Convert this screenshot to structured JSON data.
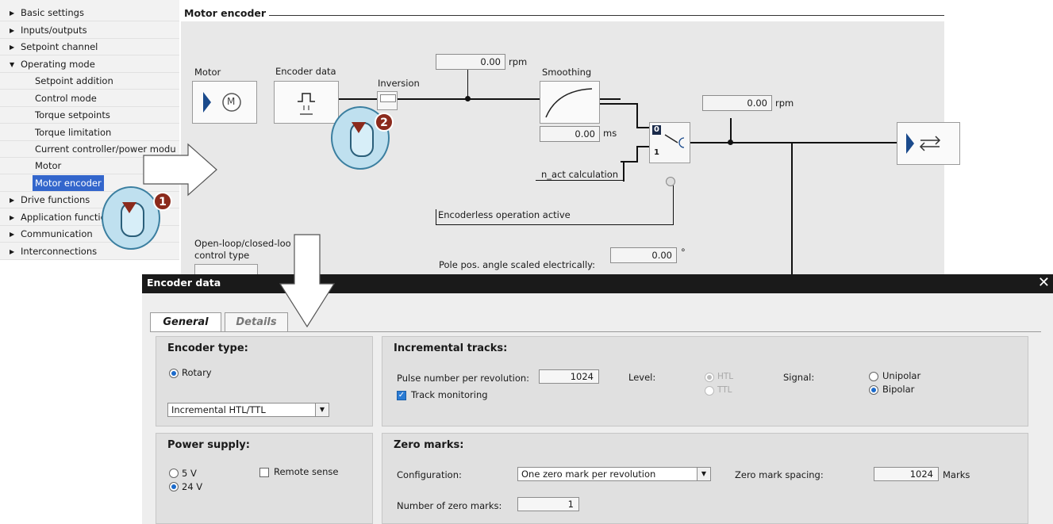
{
  "tree": {
    "items": [
      {
        "label": "Basic settings",
        "arrow": "▶"
      },
      {
        "label": "Inputs/outputs",
        "arrow": "▶"
      },
      {
        "label": "Setpoint channel",
        "arrow": "▶"
      },
      {
        "label": "Operating mode",
        "arrow": "▼"
      },
      {
        "label": "Setpoint addition"
      },
      {
        "label": "Control mode"
      },
      {
        "label": "Torque setpoints"
      },
      {
        "label": "Torque limitation"
      },
      {
        "label": "Current controller/power modu"
      },
      {
        "label": "Motor"
      },
      {
        "label": "Motor encoder"
      },
      {
        "label": "Drive functions",
        "arrow": "▶"
      },
      {
        "label": "Application functic",
        "arrow": "▶"
      },
      {
        "label": "Communication",
        "arrow": "▶"
      },
      {
        "label": "Interconnections",
        "arrow": "▶"
      }
    ]
  },
  "schematic": {
    "title": "Motor encoder",
    "motor_label": "Motor",
    "encoder_data_label": "Encoder data",
    "inversion_label": "Inversion",
    "speed_value_1": "0.00",
    "speed_unit_1": "rpm",
    "smoothing_label": "Smoothing",
    "smoothing_value": "0.00",
    "smoothing_unit": "ms",
    "speed_value_2": "0.00",
    "speed_unit_2": "rpm",
    "nact_label": "n_act calculation",
    "encoderless_label": "Encoderless operation active",
    "switch_0": "0",
    "switch_1": "1",
    "control_type_label_1": "Open-loop/closed-loo",
    "control_type_label_2": "control type",
    "pole_label": "Pole pos. angle scaled electrically:",
    "pole_value": "0.00",
    "pole_unit": "°",
    "motor_symbol": "M"
  },
  "dialog": {
    "title": "Encoder data",
    "close_glyph": "✕",
    "tabs": [
      {
        "label": "General",
        "active": true
      },
      {
        "label": "Details",
        "active": false
      }
    ],
    "encoder_type": {
      "title": "Encoder type:",
      "rotary_label": "Rotary",
      "type_value": "Incremental HTL/TTL"
    },
    "incremental_tracks": {
      "title": "Incremental tracks:",
      "pulse_label": "Pulse number per revolution:",
      "pulse_value": "1024",
      "track_monitoring_label": "Track monitoring",
      "level_label": "Level:",
      "level_options": [
        "HTL",
        "TTL"
      ],
      "signal_label": "Signal:",
      "signal_options": [
        "Unipolar",
        "Bipolar"
      ]
    },
    "power_supply": {
      "title": "Power supply:",
      "options": [
        "5 V",
        "24 V"
      ],
      "remote_sense_label": "Remote sense"
    },
    "zero_marks": {
      "title": "Zero marks:",
      "config_label": "Configuration:",
      "config_value": "One zero mark per revolution",
      "spacing_label": "Zero mark spacing:",
      "spacing_value": "1024",
      "spacing_unit": "Marks",
      "number_label": "Number of zero marks:",
      "number_value": "1"
    }
  },
  "overlay": {
    "step_1": "1",
    "step_2": "2"
  },
  "colors": {
    "selection": "#3366cc",
    "dialog_titlebar": "#1a1a1a",
    "badge": "#8b2a1c",
    "mouse_fill": "#bfe0ef"
  }
}
